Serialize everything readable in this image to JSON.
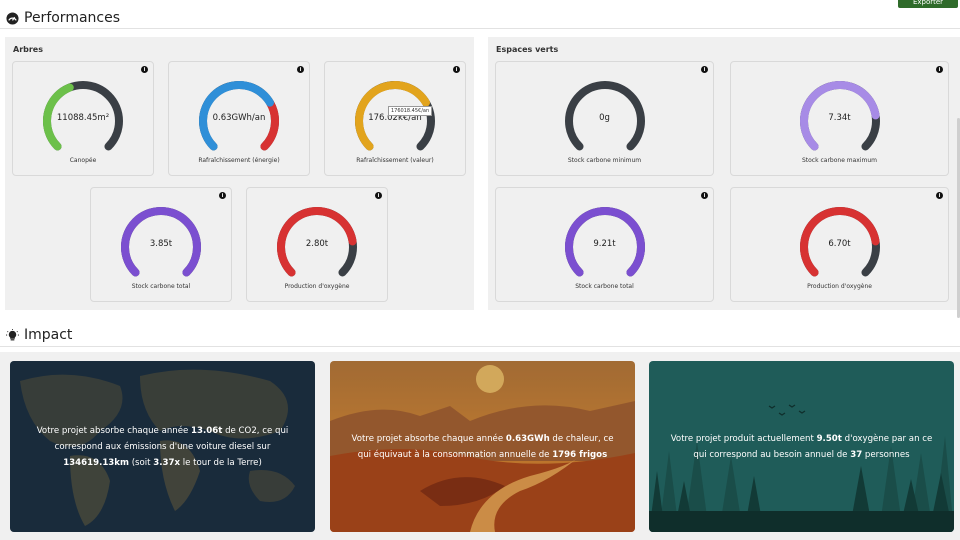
{
  "header": {
    "export_label": "Exporter"
  },
  "performances": {
    "title": "Performances",
    "arbres": {
      "title": "Arbres",
      "gauges": [
        {
          "value": "11088.45m²",
          "label": "Canopée",
          "fraction": 0.42,
          "color": "#6cc04a"
        },
        {
          "value": "0.63GWh/an",
          "label": "Rafraîchissement (énergie)",
          "fraction": 0.72,
          "color": "#2f8fd8",
          "end_color": "#d73232"
        },
        {
          "value": "176.02k€/an",
          "label": "Rafraîchissement (valeur)",
          "fraction": 0.72,
          "color": "#e2a41d",
          "tooltip": "176018.45€/an"
        },
        {
          "value": "3.85t",
          "label": "Stock carbone total",
          "fraction": 1.0,
          "color": "#7b4fd0"
        },
        {
          "value": "2.80t",
          "label": "Production d'oxygène",
          "fraction": 0.8,
          "color": "#d73232"
        }
      ]
    },
    "espaces_verts": {
      "title": "Espaces verts",
      "gauges": [
        {
          "value": "0g",
          "label": "Stock carbone minimum",
          "fraction": 0.0,
          "color": "#3a3f45"
        },
        {
          "value": "7.34t",
          "label": "Stock carbone maximum",
          "fraction": 0.8,
          "color": "#a78be6"
        },
        {
          "value": "9.21t",
          "label": "Stock carbone total",
          "fraction": 1.0,
          "color": "#7b4fd0"
        },
        {
          "value": "6.70t",
          "label": "Production d'oxygène",
          "fraction": 0.8,
          "color": "#d73232"
        }
      ]
    }
  },
  "impact": {
    "title": "Impact",
    "cards": [
      {
        "parts": [
          "Votre projet absorbe chaque année ",
          "13.06t",
          " de CO2, ce qui correspond aux émissions d'une voiture diesel sur ",
          "134619.13km",
          " (soit ",
          "3.37x",
          " le tour de la Terre)"
        ]
      },
      {
        "parts": [
          "Votre projet absorbe chaque année ",
          "0.63GWh",
          " de chaleur, ce qui équivaut à la consommation annuelle de ",
          "1796 frigos"
        ]
      },
      {
        "parts": [
          "Votre projet produit actuellement ",
          "9.50t",
          " d'oxygène par an ce qui correspond au besoin annuel de ",
          "37",
          " personnes"
        ]
      }
    ]
  },
  "colors": {
    "track": "#3a3f45",
    "panel": "#f0f0f0"
  }
}
